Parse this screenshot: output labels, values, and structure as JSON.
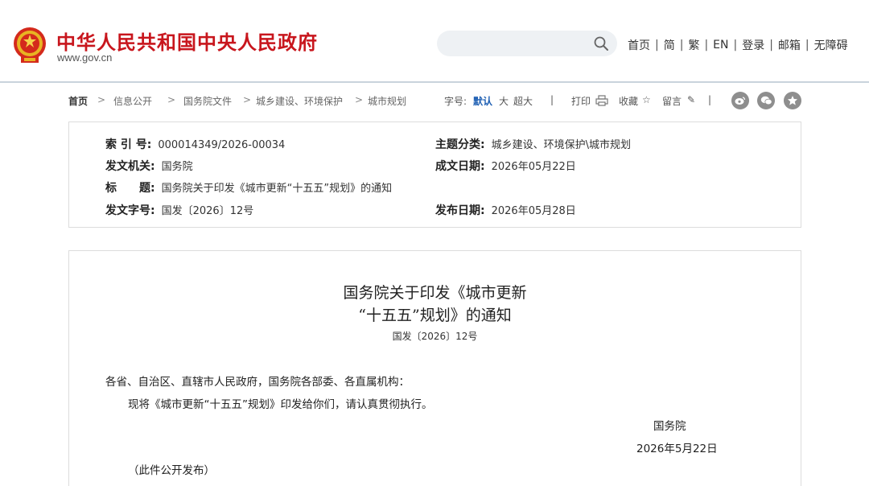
{
  "header": {
    "site_title": "中华人民共和国中央人民政府",
    "site_url": "www.gov.cn",
    "search_placeholder": "",
    "nav": [
      "首页",
      "简",
      "繁",
      "EN",
      "登录",
      "邮箱",
      "无障碍"
    ],
    "brand_color": "#c8161d"
  },
  "breadcrumb": [
    "首页",
    "信息公开",
    "国务院文件",
    "城乡建设、环境保护",
    "城市规划"
  ],
  "toolbar": {
    "font_size_label": "字号:",
    "font_default": "默认",
    "font_large": "大",
    "font_xlarge": "超大",
    "print": "打印",
    "favorite": "收藏",
    "comment": "留言",
    "share_icons": [
      "weibo-icon",
      "wechat-icon",
      "qzone-icon"
    ]
  },
  "meta": {
    "index_label": "索 引 号:",
    "index_value": "000014349/2026-00034",
    "category_label": "主题分类:",
    "category_value": "城乡建设、环境保护\\城市规划",
    "issuer_label": "发文机关:",
    "issuer_value": "国务院",
    "written_date_label": "成文日期:",
    "written_date_value": "2026年05月22日",
    "title_label": "标　　题:",
    "title_value": "国务院关于印发《城市更新“十五五”规划》的通知",
    "doc_no_label": "发文字号:",
    "doc_no_value": "国发〔2026〕12号",
    "publish_date_label": "发布日期:",
    "publish_date_value": "2026年05月28日"
  },
  "document": {
    "title_line1": "国务院关于印发《城市更新",
    "title_line2": "“十五五”规划》的通知",
    "doc_no": "国发〔2026〕12号",
    "salutation": "各省、自治区、直辖市人民政府，国务院各部委、各直属机构：",
    "body": "现将《城市更新“十五五”规划》印发给你们，请认真贯彻执行。",
    "signer": "国务院",
    "date": "2026年5月22日",
    "note": "（此件公开发布）"
  }
}
